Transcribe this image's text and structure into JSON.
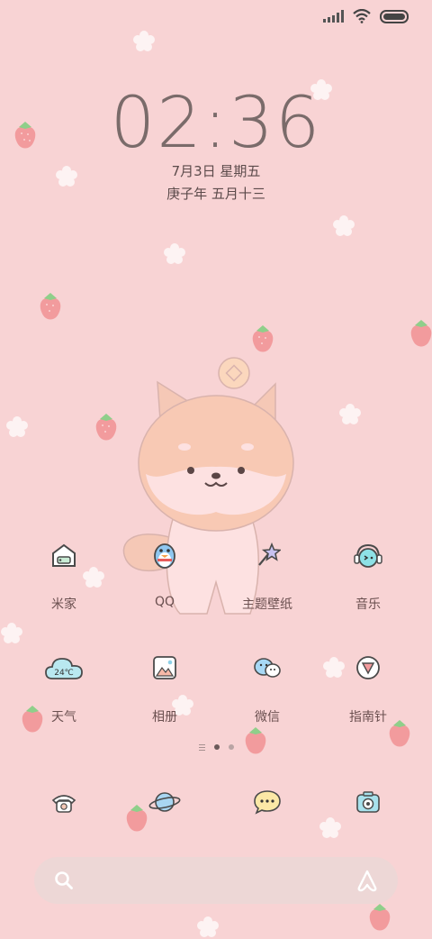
{
  "status_bar": {
    "signal_icon": "signal-icon",
    "wifi_icon": "wifi-icon",
    "battery_icon": "battery-icon"
  },
  "lockclock": {
    "time": "02:36",
    "date": "7月3日 星期五",
    "lunar": "庚子年 五月十三"
  },
  "apps_row1": [
    {
      "label": "米家",
      "icon": "mijia-house-icon"
    },
    {
      "label": "QQ",
      "icon": "qq-penguin-icon"
    },
    {
      "label": "主题壁纸",
      "icon": "theme-wand-icon"
    },
    {
      "label": "音乐",
      "icon": "music-headphones-icon"
    }
  ],
  "apps_row2": [
    {
      "label": "天气",
      "icon": "weather-cloud-icon",
      "icon_text": "24℃"
    },
    {
      "label": "相册",
      "icon": "gallery-icon"
    },
    {
      "label": "微信",
      "icon": "wechat-bubbles-icon"
    },
    {
      "label": "指南针",
      "icon": "compass-icon"
    }
  ],
  "dock": [
    {
      "icon": "phone-icon"
    },
    {
      "icon": "browser-planet-icon"
    },
    {
      "icon": "messages-icon"
    },
    {
      "icon": "camera-icon"
    }
  ],
  "page_indicator": {
    "pages": 2,
    "active": 1
  },
  "search_bar": {
    "search_icon": "search-icon",
    "assistant_icon": "assistant-icon"
  },
  "colors": {
    "background": "#f8d3d4",
    "text": "#6b5a5a",
    "accent": "#f5c8b6"
  }
}
